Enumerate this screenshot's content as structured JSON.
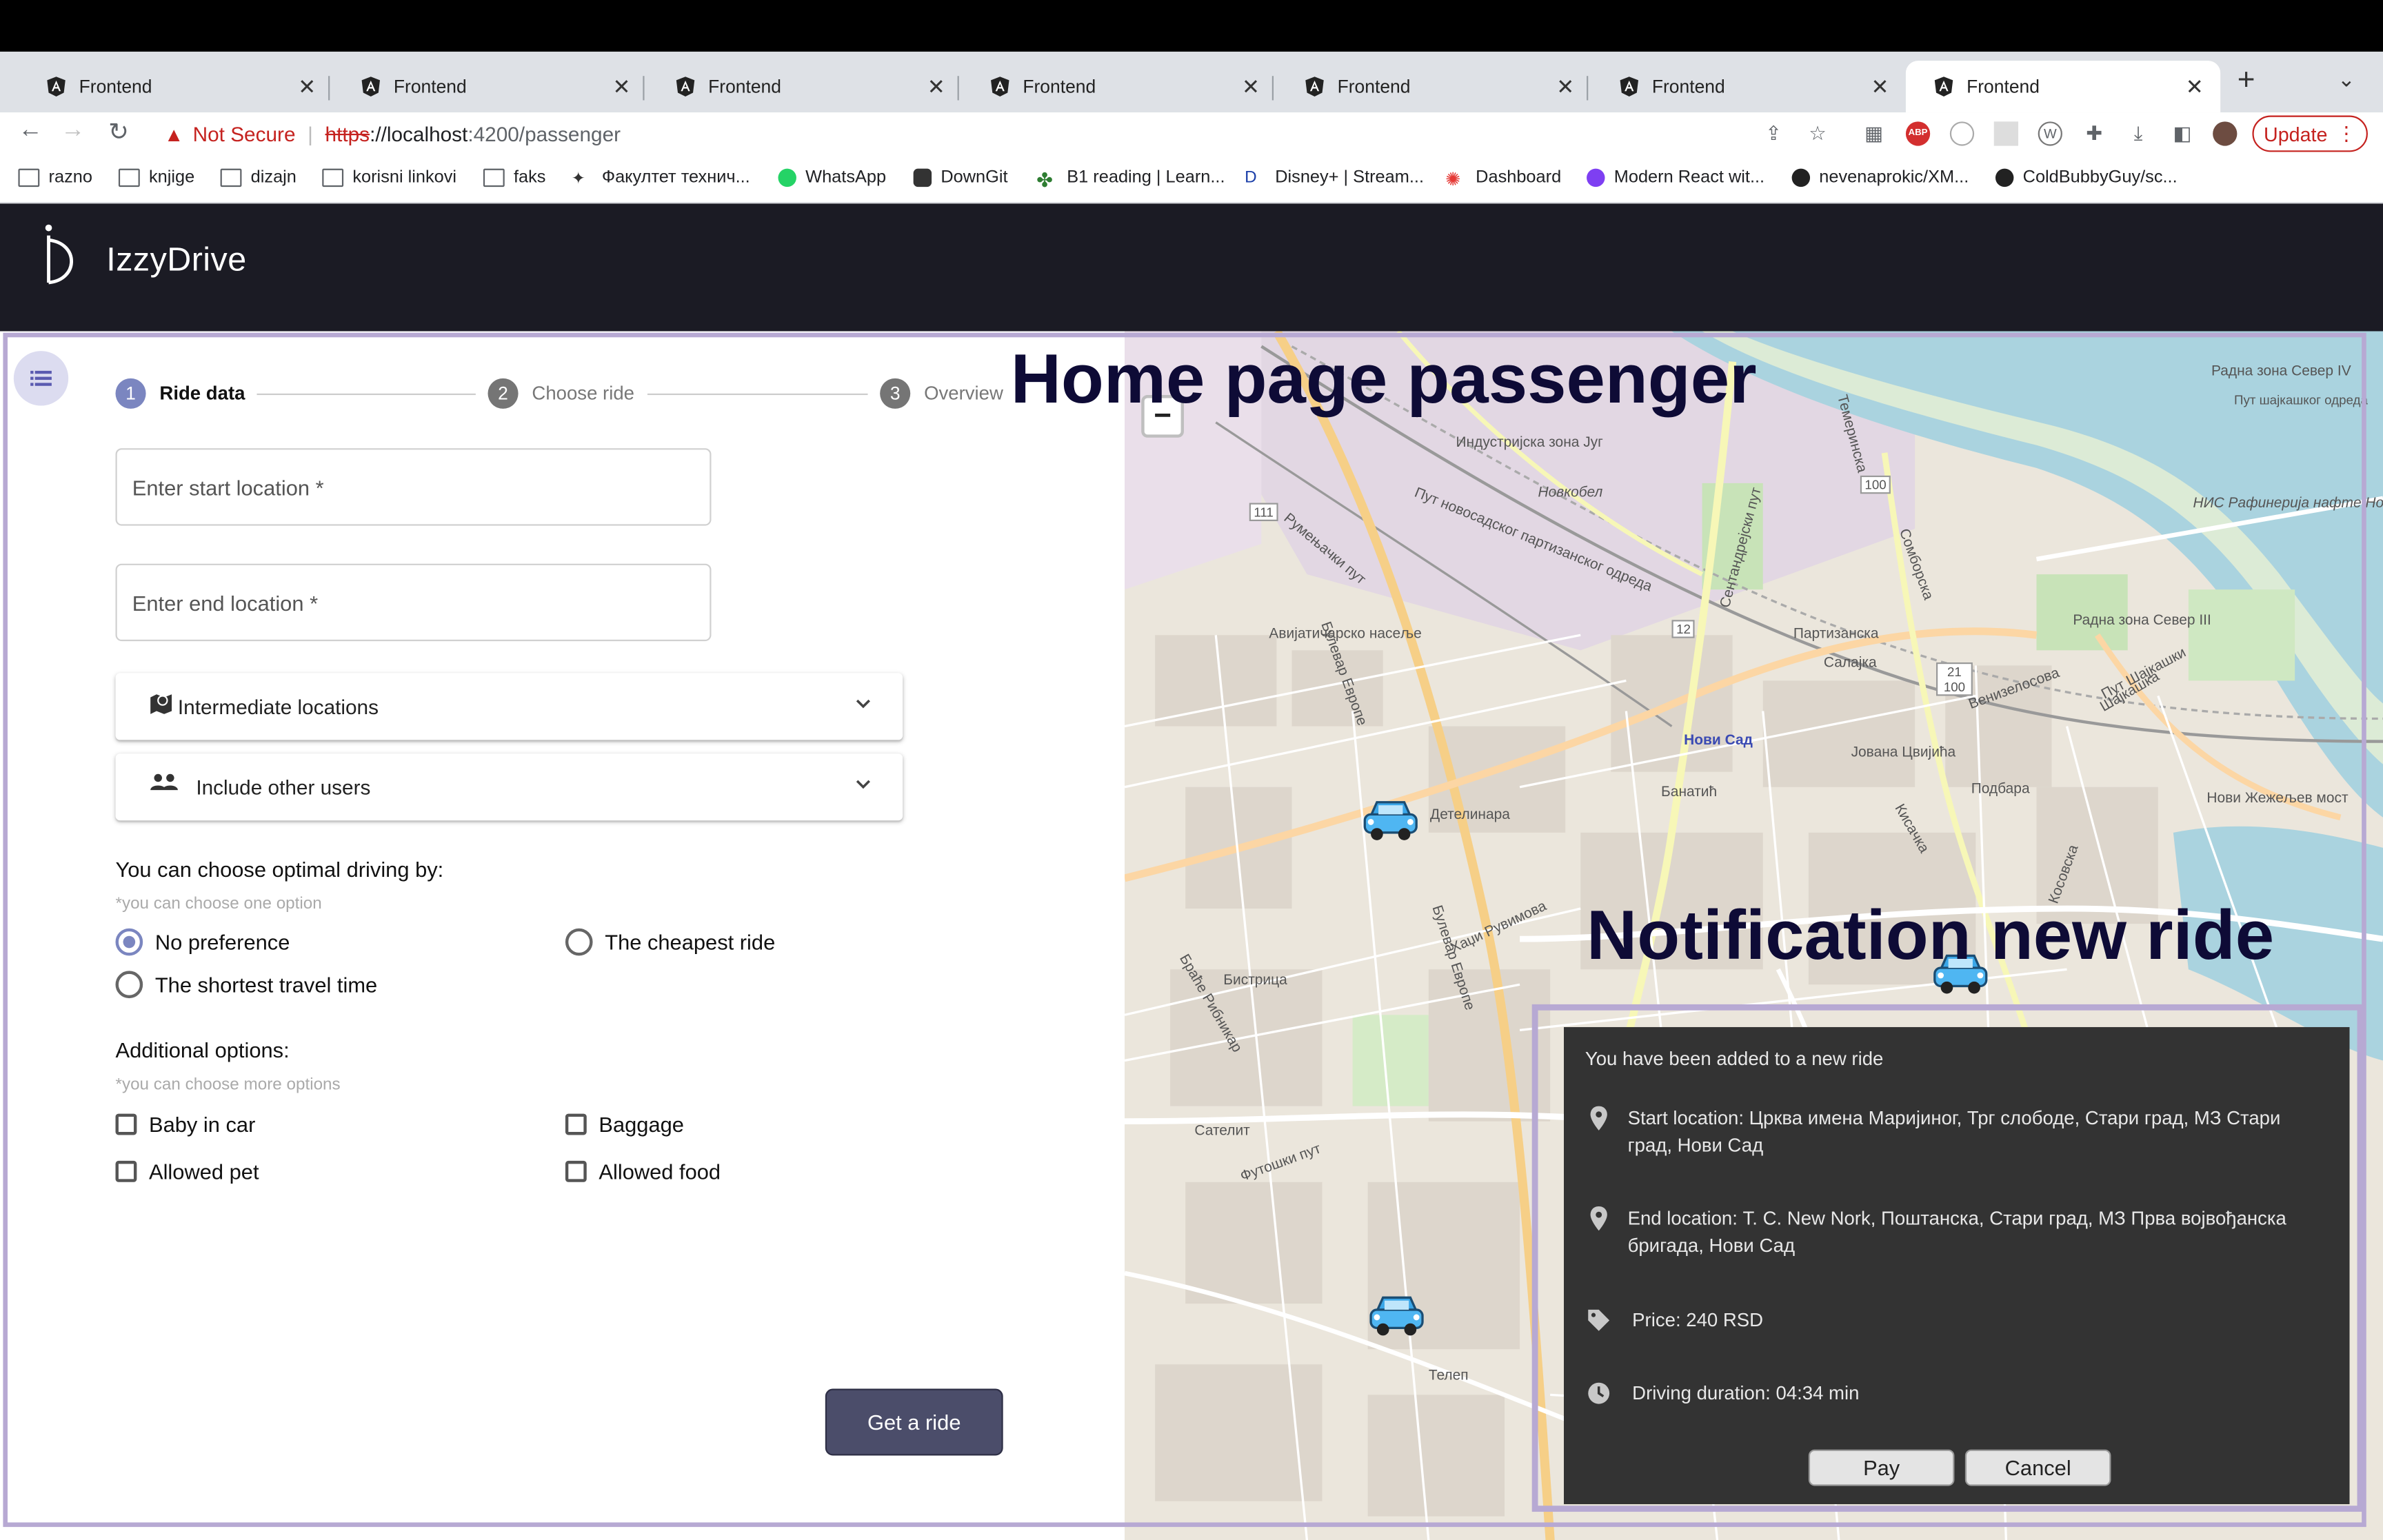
{
  "browser": {
    "tabs": [
      "Frontend",
      "Frontend",
      "Frontend",
      "Frontend",
      "Frontend",
      "Frontend",
      "Frontend"
    ],
    "active_tab_index": 6,
    "new_tab": "+",
    "url": {
      "warning": "Not Secure",
      "scheme": "https",
      "host": "://localhost",
      "path": ":4200/passenger"
    },
    "update_button": "Update",
    "bookmarks": [
      "razno",
      "knjige",
      "dizajn",
      "korisni linkovi",
      "faks",
      "Факултет технич...",
      "WhatsApp",
      "DownGit",
      "B1 reading | Learn...",
      "Disney+ | Stream...",
      "Dashboard",
      "Modern React wit...",
      "nevenaprokic/XM...",
      "ColdBubbyGuy/sc..."
    ]
  },
  "app": {
    "brand": "IzzyDrive",
    "stepper": [
      {
        "number": "1",
        "label": "Ride data",
        "state": "active"
      },
      {
        "number": "2",
        "label": "Choose ride",
        "state": "inactive"
      },
      {
        "number": "3",
        "label": "Overview",
        "state": "inactive"
      }
    ],
    "form": {
      "start_placeholder": "Enter start location *",
      "end_placeholder": "Enter end location *",
      "intermediate_label": "Intermediate locations",
      "include_users_label": "Include other users",
      "optimal_title": "You can choose optimal driving by:",
      "optimal_hint": "*you can choose one option",
      "options": [
        "No preference",
        "The cheapest ride",
        "The shortest travel time"
      ],
      "selected_option": "No preference",
      "additional_title": "Additional options:",
      "additional_hint": "*you can choose more options",
      "checkboxes": [
        "Baby in car",
        "Baggage",
        "Allowed pet",
        "Allowed food"
      ],
      "submit_label": "Get a ride"
    },
    "annotations": {
      "home": "Home page passenger",
      "notification": "Notification new ride"
    },
    "notification": {
      "title": "You have been added to a new ride",
      "start": "Start location: Црква имена Маријиног, Трг слободе, Стари град, МЗ Стари град, Нови Сад",
      "end": "End location: Т. С. New Nork, Поштанска, Стари град, МЗ Прва војвођанска бригада, Нови Сад",
      "price": "Price: 240 RSD",
      "duration": "Driving duration: 04:34 min",
      "pay_label": "Pay",
      "cancel_label": "Cancel"
    },
    "map": {
      "zoom_out": "−",
      "labels": [
        "Индустријска зона Југ",
        "Новкобел",
        "Авијатичарско насеље",
        "Детелинара",
        "Бистрица",
        "Сателит",
        "Телеп",
        "Нови Сад",
        "Салајка",
        "Банатић",
        "Подбара",
        "Радна зона Север III",
        "Радна зона Север IV",
        "НИС Рафинерија нафте Нови Сад",
        "Нови Жежељев мост",
        "Партизанска",
        "Футошки пут",
        "Булевар Европе",
        "Јована Цвијића",
        "Венизелосова",
        "Шајкашка",
        "Кисачка",
        "Румењачки пут",
        "Булевар Европе",
        "Хаџи Рувимова",
        "Браће Рибникар",
        "Сентандрејски пут",
        "Пут новосадског партизанског одреда",
        "Пут шајкашког одреда",
        "100",
        "12",
        "111",
        "21 100",
        "Темеринска",
        "Сомборска",
        "Пут Шајкашки",
        "Косовска"
      ]
    },
    "colors": {
      "header": "#1b1b24",
      "accent": "#7b86c0",
      "button": "#4b4d6a",
      "annotation_frame": "#b7a9d3",
      "annotation_text": "#0e0b36",
      "notification_bg": "#333333"
    }
  }
}
